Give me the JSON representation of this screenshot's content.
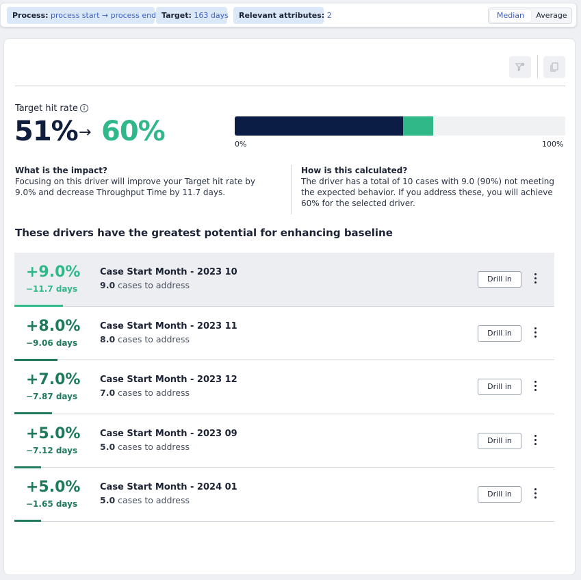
{
  "topbar": {
    "process_label": "Process:",
    "process_value": "process start → process end",
    "target_label": "Target:",
    "target_value": "163 days",
    "attributes_label": "Relevant attributes:",
    "attributes_value": "2",
    "toggle_options": [
      "Median",
      "Average"
    ],
    "toggle_selected": "Median"
  },
  "header": {
    "filter_icon": "filter-icon",
    "copy_icon": "copy-icon"
  },
  "target_hit_rate": {
    "label": "Target hit rate",
    "from": "51%",
    "arrow": "→",
    "to": "60%",
    "baseline_fraction": 0.51,
    "target_fraction": 0.6,
    "min_label": "0%",
    "max_label": "100%",
    "colors": {
      "baseline": "#0b1d45",
      "gain": "#30b889"
    }
  },
  "impact": {
    "title": "What is the impact?",
    "text": "Focusing on this driver will improve your Target hit rate by 9.0% and decrease Throughput Time by 11.7 days."
  },
  "calculation": {
    "title": "How is this calculated?",
    "text": "The driver has a total of 10 cases with 9.0 (90%) not meeting the expected behavior. If you address these, you will achieve 60% for the selected driver."
  },
  "drivers_section": {
    "title": "These drivers have the greatest potential for enhancing baseline",
    "items": [
      {
        "pct": "+9.0%",
        "days": "−11.7 days",
        "name": "Case Start Month - 2023 10",
        "cases": "9.0",
        "cases_suffix": " cases to address",
        "button": "Drill in",
        "share": 0.09,
        "active": true
      },
      {
        "pct": "+8.0%",
        "days": "−9.06 days",
        "name": "Case Start Month - 2023 11",
        "cases": "8.0",
        "cases_suffix": " cases to address",
        "button": "Drill in",
        "share": 0.08,
        "active": false
      },
      {
        "pct": "+7.0%",
        "days": "−7.87 days",
        "name": "Case Start Month - 2023 12",
        "cases": "7.0",
        "cases_suffix": " cases to address",
        "button": "Drill in",
        "share": 0.07,
        "active": false
      },
      {
        "pct": "+5.0%",
        "days": "−7.12 days",
        "name": "Case Start Month - 2023 09",
        "cases": "5.0",
        "cases_suffix": " cases to address",
        "button": "Drill in",
        "share": 0.05,
        "active": false
      },
      {
        "pct": "+5.0%",
        "days": "−1.65 days",
        "name": "Case Start Month - 2024 01",
        "cases": "5.0",
        "cases_suffix": " cases to address",
        "button": "Drill in",
        "share": 0.05,
        "active": false
      }
    ]
  }
}
